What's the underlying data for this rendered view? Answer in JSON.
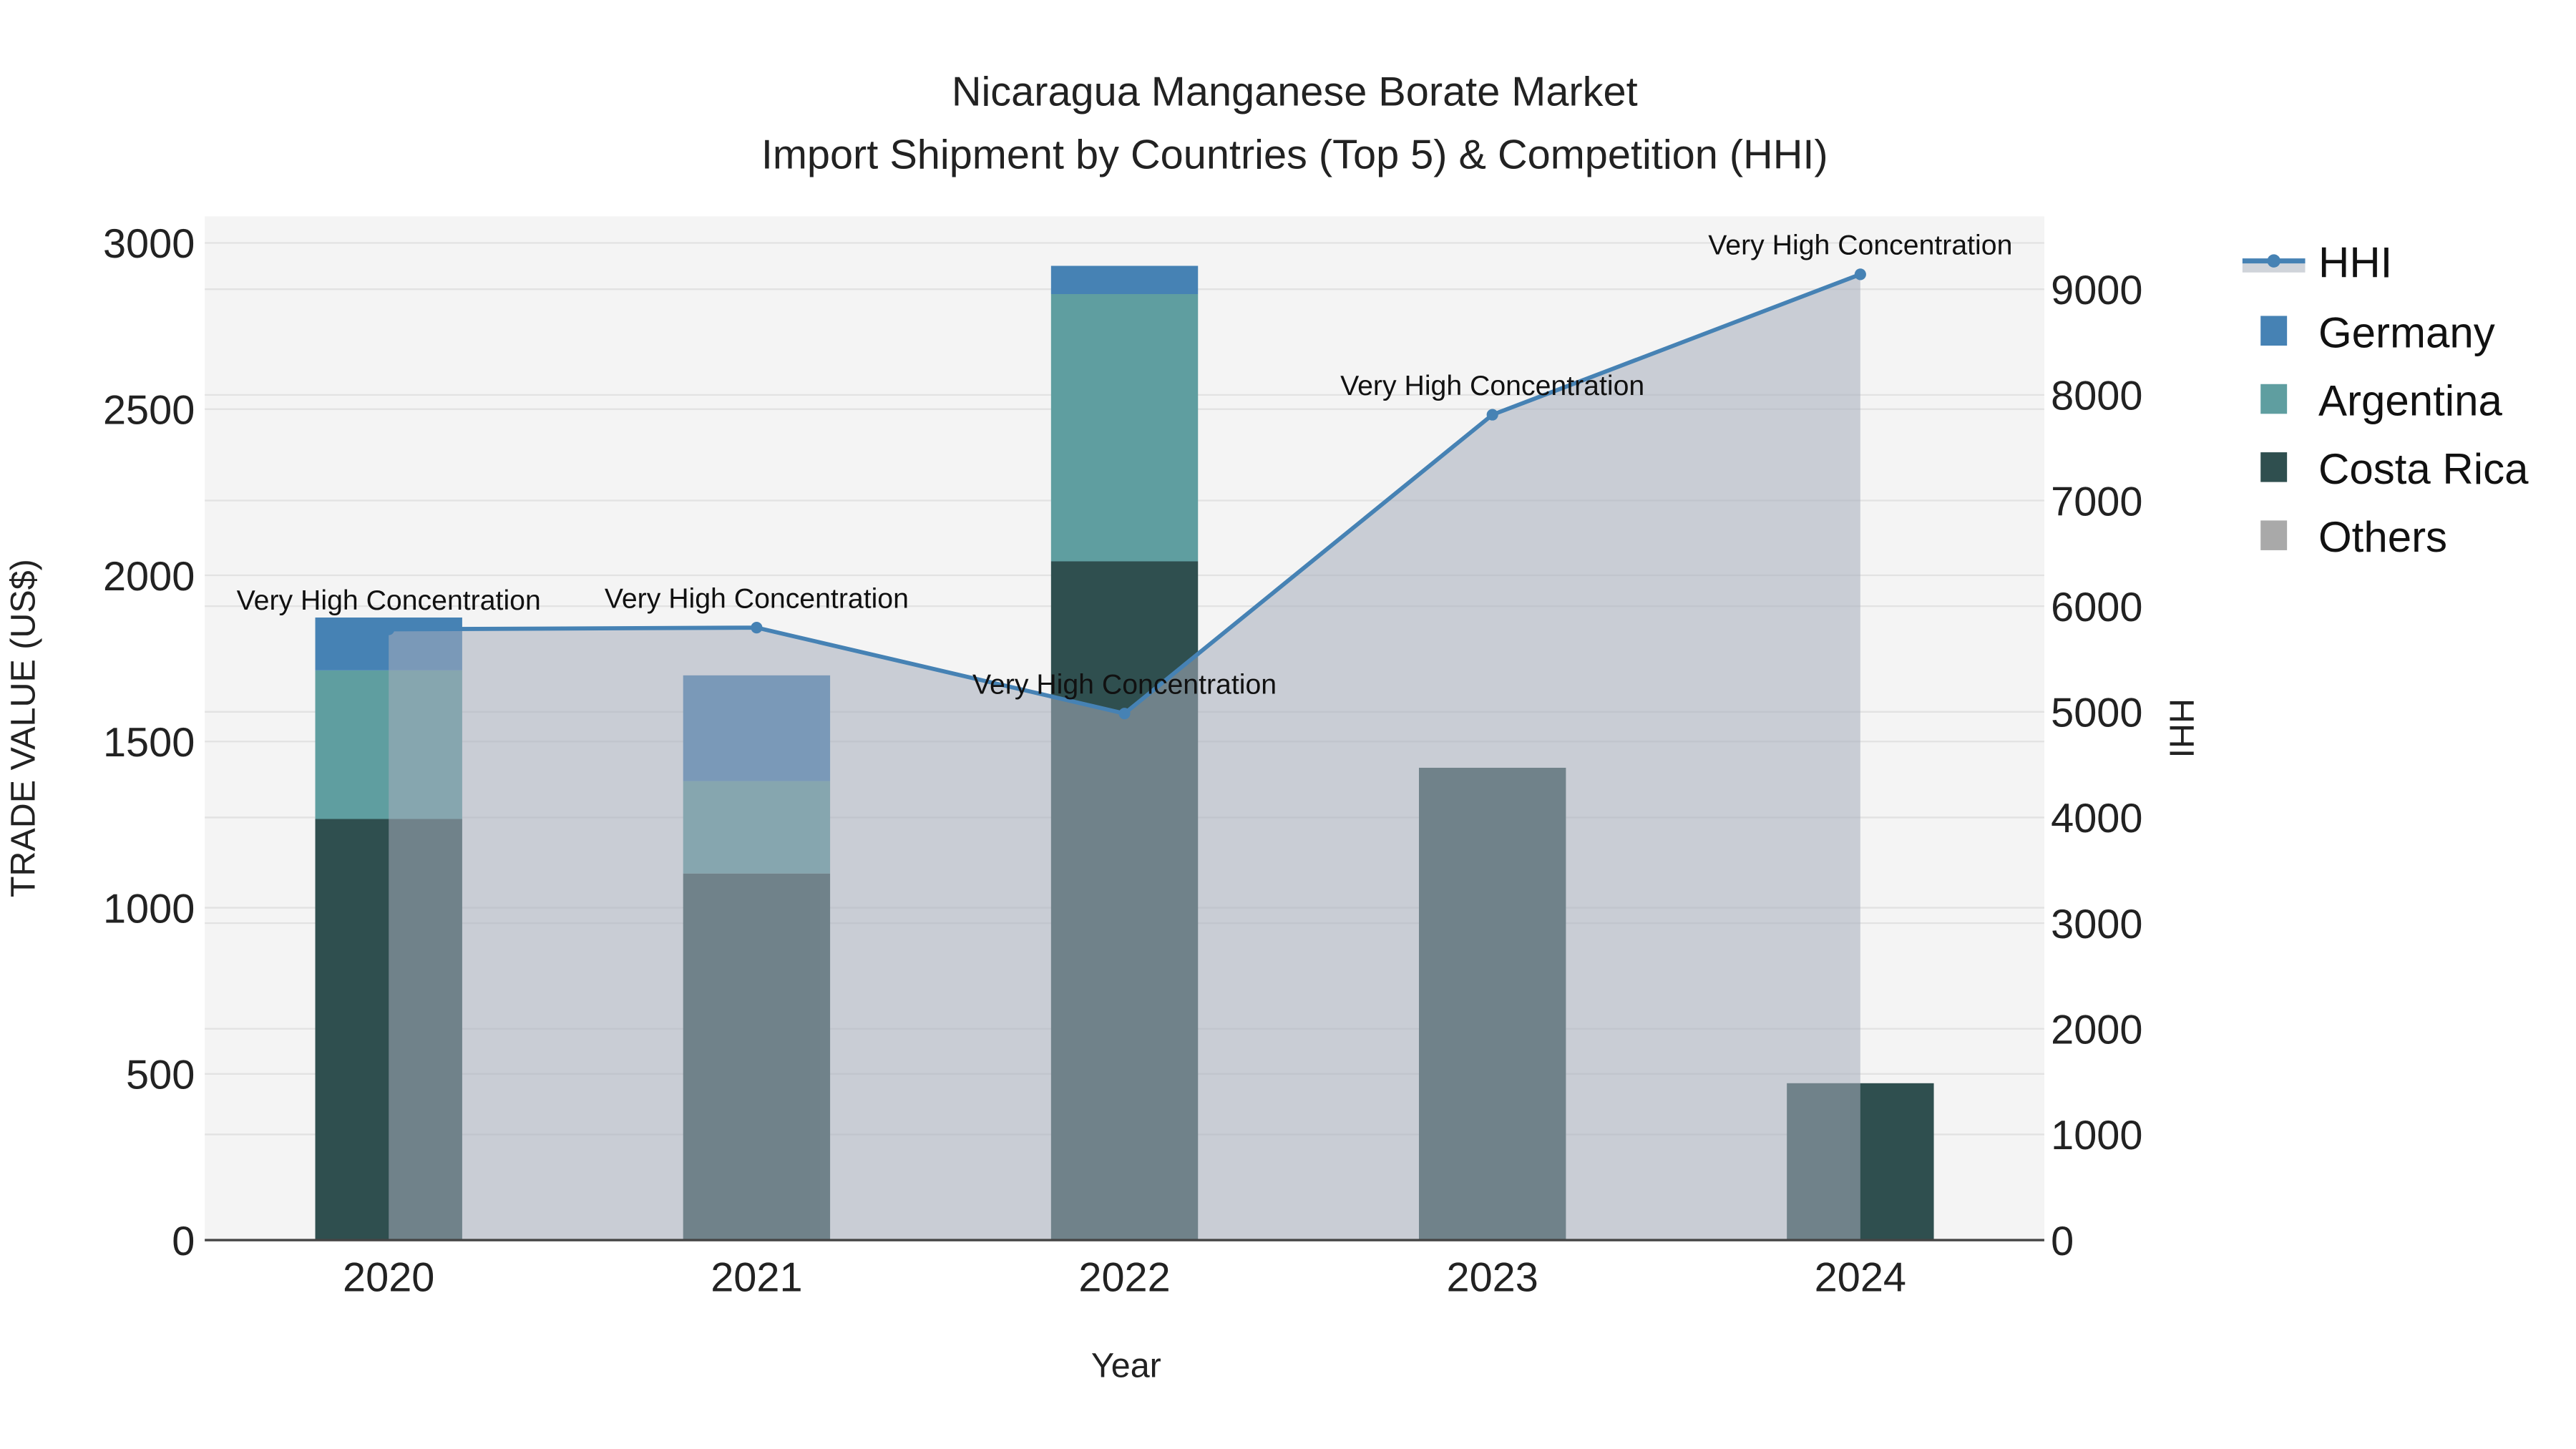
{
  "chart_data": {
    "type": "bar",
    "title_line1": "Nicaragua Manganese Borate Market",
    "title_line2": "Import Shipment by Countries (Top 5) & Competition (HHI)",
    "xlabel": "Year",
    "ylabel": "TRADE VALUE (US$)",
    "y2label": "HHI",
    "ylim": [
      0,
      3080
    ],
    "y2lim": [
      0,
      9690
    ],
    "yticks": [
      "0",
      "500",
      "1000",
      "1500",
      "2000",
      "2500",
      "3000"
    ],
    "y2ticks": [
      "0",
      "1000",
      "2000",
      "3000",
      "4000",
      "5000",
      "6000",
      "7000",
      "8000",
      "9000"
    ],
    "categories": [
      "2020",
      "2021",
      "2022",
      "2023",
      "2024"
    ],
    "series": [
      {
        "name": "Costa Rica",
        "color": "#2f4f4f",
        "values": [
          1267,
          1103,
          2042,
          1421,
          472
        ]
      },
      {
        "name": "Argentina",
        "color": "#5f9ea0",
        "values": [
          447,
          278,
          804,
          0,
          0
        ]
      },
      {
        "name": "Germany",
        "color": "#4682b4",
        "values": [
          159,
          318,
          85,
          0,
          0
        ]
      }
    ],
    "others": {
      "name": "Others",
      "color": "#a9a9a9"
    },
    "hhi": {
      "name": "HHI",
      "color": "#4682b4",
      "values": [
        5781,
        5797,
        4984,
        7812,
        9141
      ],
      "annotations": [
        "Very High Concentration",
        "Very High Concentration",
        "Very High Concentration",
        "Very High Concentration",
        "Very High Concentration"
      ]
    },
    "legend": [
      "HHI",
      "Germany",
      "Argentina",
      "Costa Rica",
      "Others"
    ],
    "legend_position": "right",
    "grid": true
  }
}
